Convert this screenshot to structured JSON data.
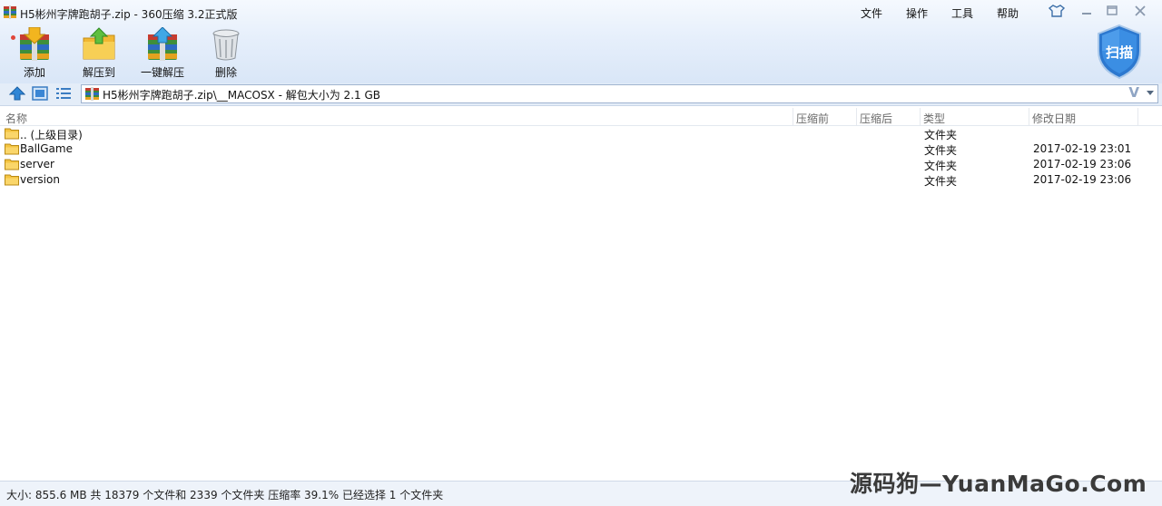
{
  "window": {
    "title": "H5彬州字牌跑胡子.zip - 360压缩 3.2正式版",
    "menus": [
      "文件",
      "操作",
      "工具",
      "帮助"
    ],
    "controls": [
      "skin",
      "minimize",
      "maximize",
      "close"
    ]
  },
  "toolbar": {
    "buttons": [
      {
        "label": "添加",
        "icon": "archive-add-icon"
      },
      {
        "label": "解压到",
        "icon": "folder-extract-icon"
      },
      {
        "label": "一键解压",
        "icon": "archive-extract-icon"
      },
      {
        "label": "删除",
        "icon": "trash-bin-icon"
      }
    ],
    "scan_label": "扫描"
  },
  "address_bar": {
    "path": "H5彬州字牌跑胡子.zip\\__MACOSX - 解包大小为 2.1 GB",
    "v_label": "V"
  },
  "columns": {
    "name": "名称",
    "before": "压缩前",
    "after": "压缩后",
    "type": "类型",
    "modified": "修改日期"
  },
  "rows": [
    {
      "name": ".. (上级目录)",
      "type": "文件夹",
      "modified": ""
    },
    {
      "name": "BallGame",
      "type": "文件夹",
      "modified": "2017-02-19 23:01"
    },
    {
      "name": "server",
      "type": "文件夹",
      "modified": "2017-02-19 23:06"
    },
    {
      "name": "version",
      "type": "文件夹",
      "modified": "2017-02-19 23:06"
    }
  ],
  "status": {
    "text": "大小: 855.6 MB 共 18379 个文件和 2339 个文件夹 压缩率 39.1% 已经选择 1 个文件夹"
  },
  "watermark": "源码狗—YuanMaGo.Com",
  "colors": {
    "band_top": "#f5f9fe",
    "band_bottom": "#d9e6f7",
    "accent_blue": "#1e6fd0",
    "folder_yellow": "#f5c542"
  }
}
